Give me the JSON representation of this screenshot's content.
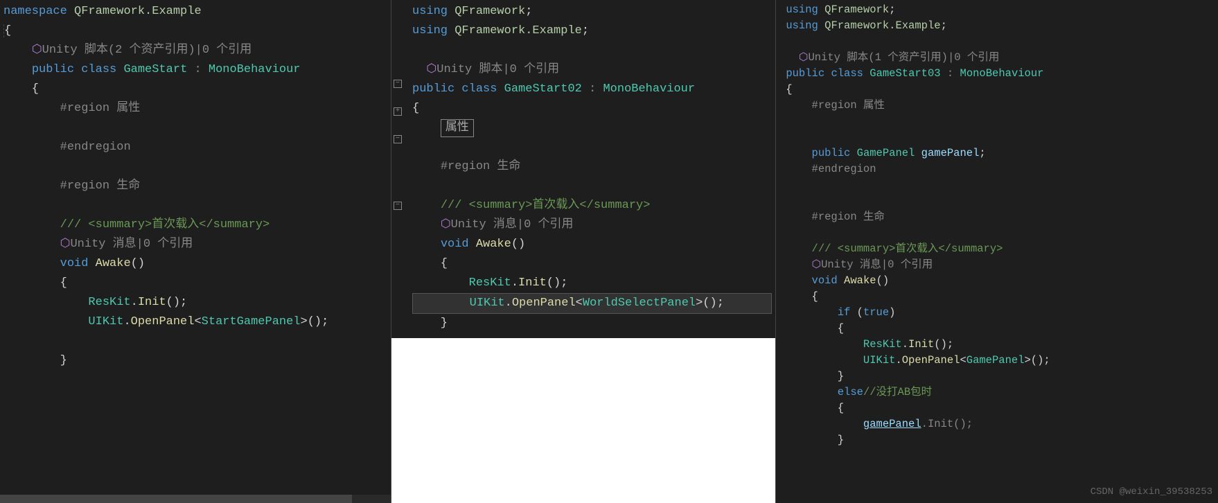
{
  "watermark": "CSDN @weixin_39538253",
  "pane1": {
    "namespace_kw": "namespace",
    "namespace_name": "QFramework.Example",
    "unity_script_hint": "Unity 脚本(2 个资产引用)|0 个引用",
    "public_kw": "public",
    "class_kw": "class",
    "class_name": "GameStart",
    "colon": ":",
    "base_class": "MonoBehaviour",
    "region1": "#region 属性",
    "endregion1": "#endregion",
    "region2": "#region 生命",
    "summary_comment": "/// <summary>首次载入</summary>",
    "unity_msg_hint": "Unity 消息|0 个引用",
    "void_kw": "void",
    "method_name": "Awake",
    "reskit": "ResKit",
    "init": "Init",
    "uikit": "UIKit",
    "openpanel": "OpenPanel",
    "panel_type": "StartGamePanel"
  },
  "pane2": {
    "using_kw": "using",
    "using1": "QFramework",
    "using2": "QFramework.Example",
    "unity_script_hint": "Unity 脚本|0 个引用",
    "public_kw": "public",
    "class_kw": "class",
    "class_name": "GameStart02",
    "colon": ":",
    "base_class": "MonoBehaviour",
    "region_box": "属性",
    "region2": "#region 生命",
    "summary_comment": "/// <summary>首次载入</summary>",
    "unity_msg_hint": "Unity 消息|0 个引用",
    "void_kw": "void",
    "method_name": "Awake",
    "reskit": "ResKit",
    "init": "Init",
    "uikit": "UIKit",
    "openpanel": "OpenPanel",
    "panel_type": "WorldSelectPanel"
  },
  "pane3": {
    "using_kw": "using",
    "using1": "QFramework",
    "using2": "QFramework.Example",
    "unity_script_hint": "Unity 脚本(1 个资产引用)|0 个引用",
    "public_kw": "public",
    "class_kw": "class",
    "class_name": "GameStart03",
    "colon": ":",
    "base_class": "MonoBehaviour",
    "region1": "#region 属性",
    "field_public": "public",
    "field_type": "GamePanel",
    "field_name": "gamePanel",
    "endregion1": "#endregion",
    "region2": "#region 生命",
    "summary_comment": "/// <summary>首次载入</summary>",
    "unity_msg_hint": "Unity 消息|0 个引用",
    "void_kw": "void",
    "method_name": "Awake",
    "if_kw": "if",
    "true_kw": "true",
    "reskit": "ResKit",
    "init": "Init",
    "uikit": "UIKit",
    "openpanel": "OpenPanel",
    "panel_type": "GamePanel",
    "else_kw": "else",
    "else_comment": "//没打AB包时",
    "gamepanel_var": "gamePanel",
    "init2": "Init"
  }
}
